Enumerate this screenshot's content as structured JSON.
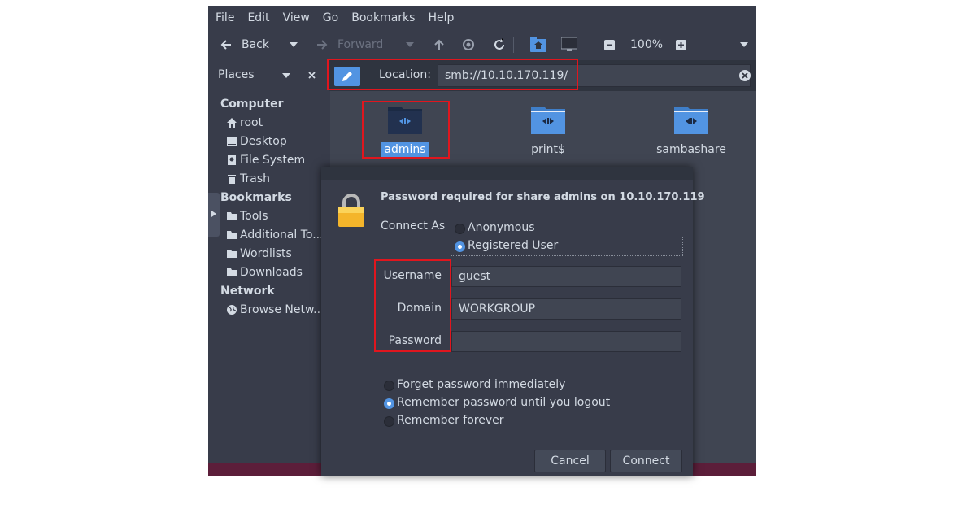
{
  "menu": [
    "File",
    "Edit",
    "View",
    "Go",
    "Bookmarks",
    "Help"
  ],
  "toolbar": {
    "back": "Back",
    "forward": "Forward",
    "zoom": "100%"
  },
  "places": {
    "title": "Places"
  },
  "location": {
    "label": "Location:",
    "value": "smb://10.10.170.119/"
  },
  "sidebar": {
    "computer": "Computer",
    "computer_items": [
      "root",
      "Desktop",
      "File System",
      "Trash"
    ],
    "bookmarks": "Bookmarks",
    "bookmark_items": [
      "Tools",
      "Additional To...",
      "Wordlists",
      "Downloads"
    ],
    "network": "Network",
    "network_items": [
      "Browse Netw..."
    ]
  },
  "files": [
    "admins",
    "print$",
    "sambashare"
  ],
  "dialog": {
    "title": "Password required for share admins on 10.10.170.119",
    "connect_as": "Connect As",
    "anonymous": "Anonymous",
    "registered": "Registered User",
    "username_label": "Username",
    "username_value": "guest",
    "domain_label": "Domain",
    "domain_value": "WORKGROUP",
    "password_label": "Password",
    "password_value": "",
    "forget": "Forget password immediately",
    "remember_logout": "Remember password until you logout",
    "remember_forever": "Remember forever",
    "cancel": "Cancel",
    "connect": "Connect"
  },
  "colors": {
    "accent": "#5294e2",
    "highlight": "#e0161e"
  }
}
